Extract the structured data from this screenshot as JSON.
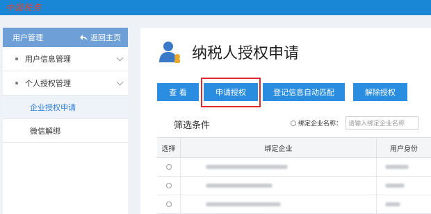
{
  "header": {
    "logo_text": "中国税务"
  },
  "sidebar": {
    "title": "用户管理",
    "back_label": "返回主页",
    "items": [
      {
        "label": "用户信息管理"
      },
      {
        "label": "个人授权管理"
      }
    ],
    "subitems": [
      {
        "label": "企业授权申请",
        "active": true
      },
      {
        "label": "微信解绑"
      }
    ]
  },
  "main": {
    "title": "纳税人授权申请",
    "buttons": {
      "view": "查 看",
      "apply": "申请授权",
      "auto_match": "登记信息自动匹配",
      "revoke": "解除授权"
    },
    "filter": {
      "label": "筛选条件",
      "field_label": "绑定企业名称：",
      "placeholder": "请输入绑定企业名称"
    },
    "table": {
      "columns": [
        "选择",
        "绑定企业",
        "用户身份"
      ]
    }
  },
  "colors": {
    "topbar": "#1a86d6",
    "sidebar_header": "#6e9fd6",
    "button": "#2a8de0",
    "highlight": "#e02828"
  }
}
